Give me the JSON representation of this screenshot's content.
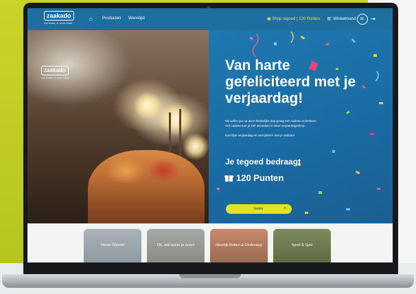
{
  "nav": {
    "logo_brand": "zaakado",
    "logo_tagline": "Uw Kado, is onze Zaak",
    "home_icon": "home-icon",
    "products": "Producten",
    "wishlist": "Wenslijst",
    "shop_credit": "Shop tegoed | 120 Punten",
    "cart": "Winkelmand",
    "language": "NL",
    "logout_icon": "logout-icon"
  },
  "hero": {
    "logo_brand": "zaakado",
    "logo_tagline": "Uw Kado, is onze Zaak",
    "title": "Van harte gefeliciteerd met je verjaardag!",
    "text_line1": "Wij willen jou op deze feestelijke dag graag een cadeau schenken!",
    "text_line2": "Het cadeau kun je zelf uitzoeken in deze verjaardagsshop.",
    "text_line3": "Een fijne verjaardag en veel plezier met je cadeau!",
    "balance_label": "Je tegoed bedraagt",
    "balance_value": "120 Punten",
    "button_label": "Verder",
    "button_arrow": "»"
  },
  "categories": [
    {
      "label": "Mooie Wereld"
    },
    {
      "label": "Oh, wat woon je mooi!"
    },
    {
      "label": "Heerlijk Buiten & Onderweg"
    },
    {
      "label": "Sport & Spel"
    }
  ],
  "colors": {
    "nav_blue": "#1f6ea0",
    "hero_blue": "#1a6aa2",
    "accent_yellow": "#e0e31f",
    "background_lime": "#c9d32a"
  }
}
